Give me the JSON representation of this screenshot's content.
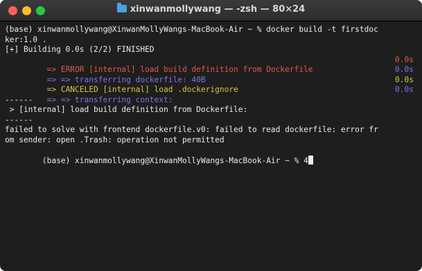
{
  "window": {
    "title": "xinwanmollywang — -zsh — 80×24",
    "folder_icon": "folder-icon"
  },
  "colors": {
    "background": "#1e1e1e",
    "text": "#ececec",
    "error": "#e2564a",
    "step": "#7b73e6",
    "canceled": "#d9c642"
  },
  "terminal": {
    "lines": {
      "command_1": "(base) xinwanmollywang@XinwanMollyWangs-MacBook-Air ~ % docker build -t firstdoc",
      "command_2": "ker:1.0 .",
      "building": "[+] Building 0.0s (2/2) FINISHED",
      "error_step": " => ERROR [internal] load build definition from Dockerfile",
      "error_step_time": "0.0s",
      "transfer_dockerfile": " => => transferring dockerfile: 40B",
      "transfer_dockerfile_time": "0.0s",
      "canceled_step": " => CANCELED [internal] load .dockerignore",
      "canceled_step_time": "0.0s",
      "transfer_context": " => => transferring context:",
      "transfer_context_time": "0.0s",
      "separator_1": "------",
      "internal_load": " > [internal] load build definition from Dockerfile:",
      "separator_2": "------",
      "failed_1": "failed to solve with frontend dockerfile.v0: failed to read dockerfile: error fr",
      "failed_2": "om sender: open .Trash: operation not permitted",
      "prompt": "(base) xinwanmollywang@XinwanMollyWangs-MacBook-Air ~ % 4"
    }
  }
}
